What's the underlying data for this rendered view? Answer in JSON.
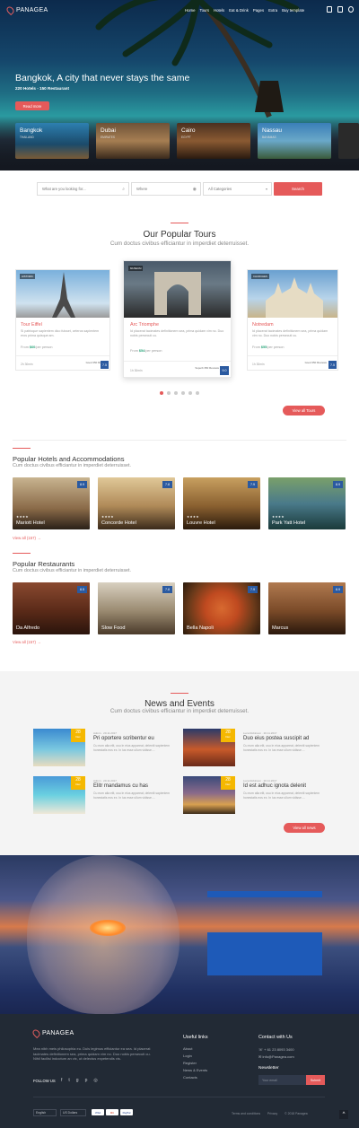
{
  "brand": {
    "name": "PANAGEA",
    "accent": "#e55a5a",
    "score_color": "#2b5aa0",
    "date_color": "#f5b800"
  },
  "nav": {
    "items": [
      "Home",
      "Tours",
      "Hotels",
      "Eat & Drink",
      "Pages",
      "Extra",
      "Buy template"
    ]
  },
  "hero": {
    "title": "Bangkok, A city that never stays the same",
    "subtitle": "220 Hotels - 150 Restaurant",
    "cta": "Read more",
    "cities": [
      {
        "name": "Bangkok",
        "country": "THAILAND"
      },
      {
        "name": "Dubai",
        "country": "EMIRATES"
      },
      {
        "name": "Cairo",
        "country": "EGYPT"
      },
      {
        "name": "Nassau",
        "country": "BAHAMAS"
      }
    ]
  },
  "search": {
    "what_placeholder": "What are you looking for...",
    "where_placeholder": "Where",
    "category": "All Categories",
    "button": "Search"
  },
  "tours": {
    "title": "Our Popular Tours",
    "subtitle": "Cum doctus civibus efficiantur in imperdiet deterruisset.",
    "items": [
      {
        "tag": "HISTORIC",
        "name": "Tour Eiffel",
        "desc": "Si patrioque sapientem dico fuisset, ceteros sapientem eros prima quisque am.",
        "price_label": "From",
        "price": "$60",
        "per": "/per person",
        "duration": "2h 30min",
        "reviews": "Good 350 Reviews",
        "score": "7.5"
      },
      {
        "tag": "MUSEUM",
        "name": "Arc Triomphe",
        "desc": "Id placerat tacimates definitionem sea, prima quidam vim no. Duo nobis persecuti cu.",
        "price_label": "From",
        "price": "$54",
        "per": "/per person",
        "duration": "1h 30min",
        "reviews": "Superb 350 Reviews",
        "score": "9.0"
      },
      {
        "tag": "CHURCHES",
        "name": "Notredam",
        "desc": "Id placerat tacimates definitionem sea, prima quidam vim no. Duo nobis persecuti cu.",
        "price_label": "From",
        "price": "$55",
        "per": "/per person",
        "duration": "1h 30min",
        "reviews": "Good 350 Reviews",
        "score": "7.5"
      }
    ],
    "view_all": "View all Tours"
  },
  "hotels": {
    "title": "Popular Hotels and Accommodations",
    "subtitle": "Cum doctus civibus efficiantur in imperdiet deterruisset.",
    "items": [
      {
        "name": "Mariott Hotel",
        "stars": "★★★★",
        "score": "8.9"
      },
      {
        "name": "Concorde Hotel",
        "stars": "★★★★",
        "score": "7.8"
      },
      {
        "name": "Louvre Hotel",
        "stars": "★★★★",
        "score": "7.9"
      },
      {
        "name": "Park Yatt Hotel",
        "stars": "★★★★",
        "score": "8.9"
      }
    ],
    "view_all": "View all (157)"
  },
  "restaurants": {
    "title": "Popular Restaurants",
    "subtitle": "Cum doctus civibus efficiantur in imperdiet deterruisset.",
    "items": [
      {
        "name": "Da Alfredo",
        "score": "8.5"
      },
      {
        "name": "Slow Food",
        "score": "7.8"
      },
      {
        "name": "Bella Napoli",
        "score": "7.9"
      },
      {
        "name": "Marcus",
        "score": "8.9"
      }
    ],
    "view_all": "View all (157)"
  },
  "news": {
    "title": "News and Events",
    "subtitle": "Cum doctus civibus efficiantur in imperdiet deterruisset.",
    "items": [
      {
        "day": "28",
        "month": "Dec",
        "meta": "Admin  ·  20.11.2017",
        "title": "Pri oportere scribentur eu",
        "text": "Cu eum alia elit, usu in eius appareat, deleniti sapientem honestatis eos ex. In ius esse ullum vidisse...."
      },
      {
        "day": "28",
        "month": "Dec",
        "meta": "Luca Robinson  ·  20.11.2017",
        "title": "Duo eius postea suscipit ad",
        "text": "Cu eum alia elit, usu in eius appareat, deleniti sapientem honestatis eos ex. In ius esse ullum vidisse...."
      },
      {
        "day": "28",
        "month": "Dec",
        "meta": "Admin  ·  20.11.2017",
        "title": "Elitr mandamus cu has",
        "text": "Cu eum alia elit, usu in eius appareat, deleniti sapientem honestatis eos ex. In ius esse ullum vidisse...."
      },
      {
        "day": "28",
        "month": "Dec",
        "meta": "Luca Robinson  ·  20.11.2017",
        "title": "Id est adhuc ignota delenit",
        "text": "Cu eum alia elit, usu in eius appareat, deleniti sapientem honestatis eos ex. In ius esse ullum vidisse...."
      }
    ],
    "view_all": "View all news"
  },
  "footer": {
    "brand": "PANAGEA",
    "about": "Mea nibh meis philosophia eu. Duis legimus efficiantur ea sea. Id placerat tacimates definitionem sea, prima quidam vim no. Duo nobis persecuti cu. Nihil facilisi indoctum an vix, ut delectus expetendis vis.",
    "follow": "FOLLOW US",
    "useful_title": "Useful links",
    "links": [
      "About",
      "Login",
      "Register",
      "News & Events",
      "Contacts"
    ],
    "contact_title": "Contact with Us",
    "phone": "+ 61 23 8093 3400",
    "email": "info@Panagea.com",
    "newsletter_title": "Newsletter",
    "newsletter_placeholder": "Your email",
    "newsletter_button": "Submit",
    "language": "English",
    "currency": "US Dollars",
    "payments": [
      "VISA",
      "MC",
      "PayPal"
    ],
    "bottom_links": [
      "Terms and conditions",
      "Privacy",
      "© 2018 Panagea"
    ]
  }
}
